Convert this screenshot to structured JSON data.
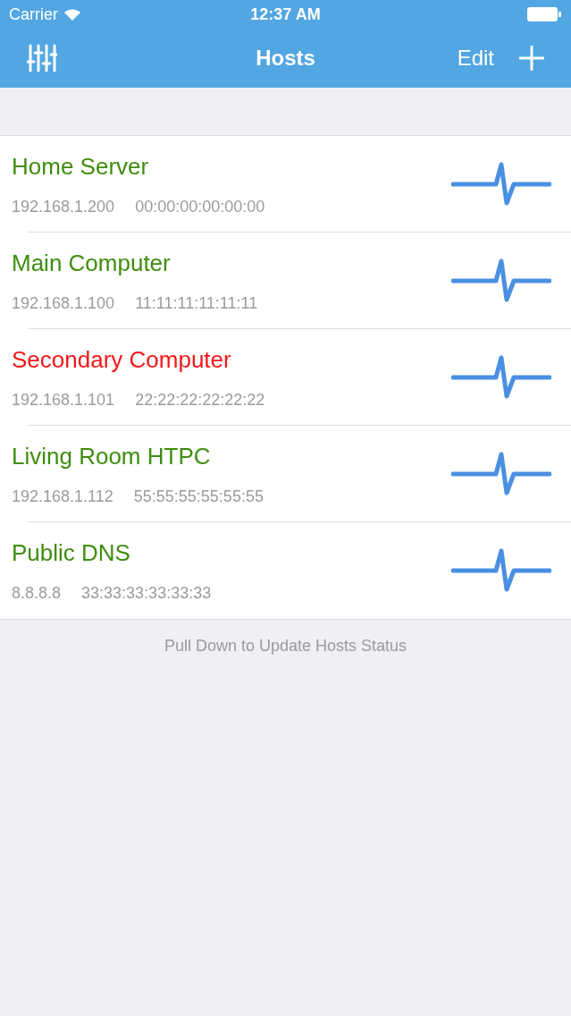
{
  "status_bar": {
    "carrier": "Carrier",
    "time": "12:37 AM"
  },
  "nav": {
    "title": "Hosts",
    "edit": "Edit"
  },
  "hosts": [
    {
      "name": "Home Server",
      "ip": "192.168.1.200",
      "mac": "00:00:00:00:00:00",
      "online": true
    },
    {
      "name": "Main Computer",
      "ip": "192.168.1.100",
      "mac": "11:11:11:11:11:11",
      "online": true
    },
    {
      "name": "Secondary Computer",
      "ip": "192.168.1.101",
      "mac": "22:22:22:22:22:22",
      "online": false
    },
    {
      "name": "Living Room HTPC",
      "ip": "192.168.1.112",
      "mac": "55:55:55:55:55:55",
      "online": true
    },
    {
      "name": "Public DNS",
      "ip": "8.8.8.8",
      "mac": "33:33:33:33:33:33",
      "online": true
    }
  ],
  "footer": "Pull Down to Update Hosts Status"
}
